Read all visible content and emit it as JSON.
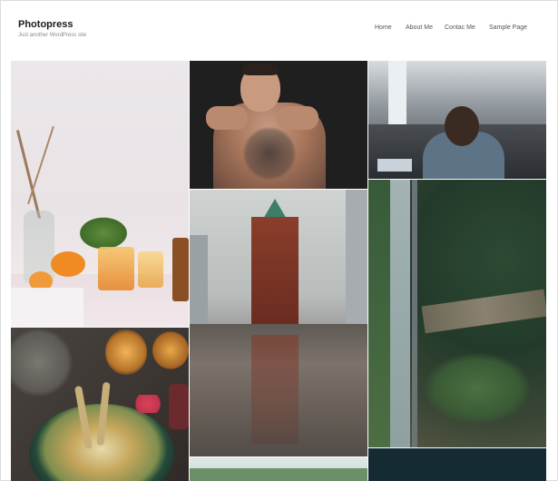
{
  "site": {
    "title": "Photopress",
    "tagline": "Just another WordPress site"
  },
  "nav": {
    "items": [
      {
        "label": "Home"
      },
      {
        "label": "About Me"
      },
      {
        "label": "Contac Me"
      },
      {
        "label": "Sample Page"
      }
    ]
  },
  "gallery": {
    "tiles": [
      {
        "name": "orange-drinks-photo"
      },
      {
        "name": "tattooed-man-photo"
      },
      {
        "name": "station-laptop-photo"
      },
      {
        "name": "flatiron-rain-photo"
      },
      {
        "name": "aerial-road-forest-photo"
      },
      {
        "name": "salad-table-photo"
      },
      {
        "name": "city-trees-photo"
      },
      {
        "name": "dark-water-photo"
      }
    ]
  }
}
